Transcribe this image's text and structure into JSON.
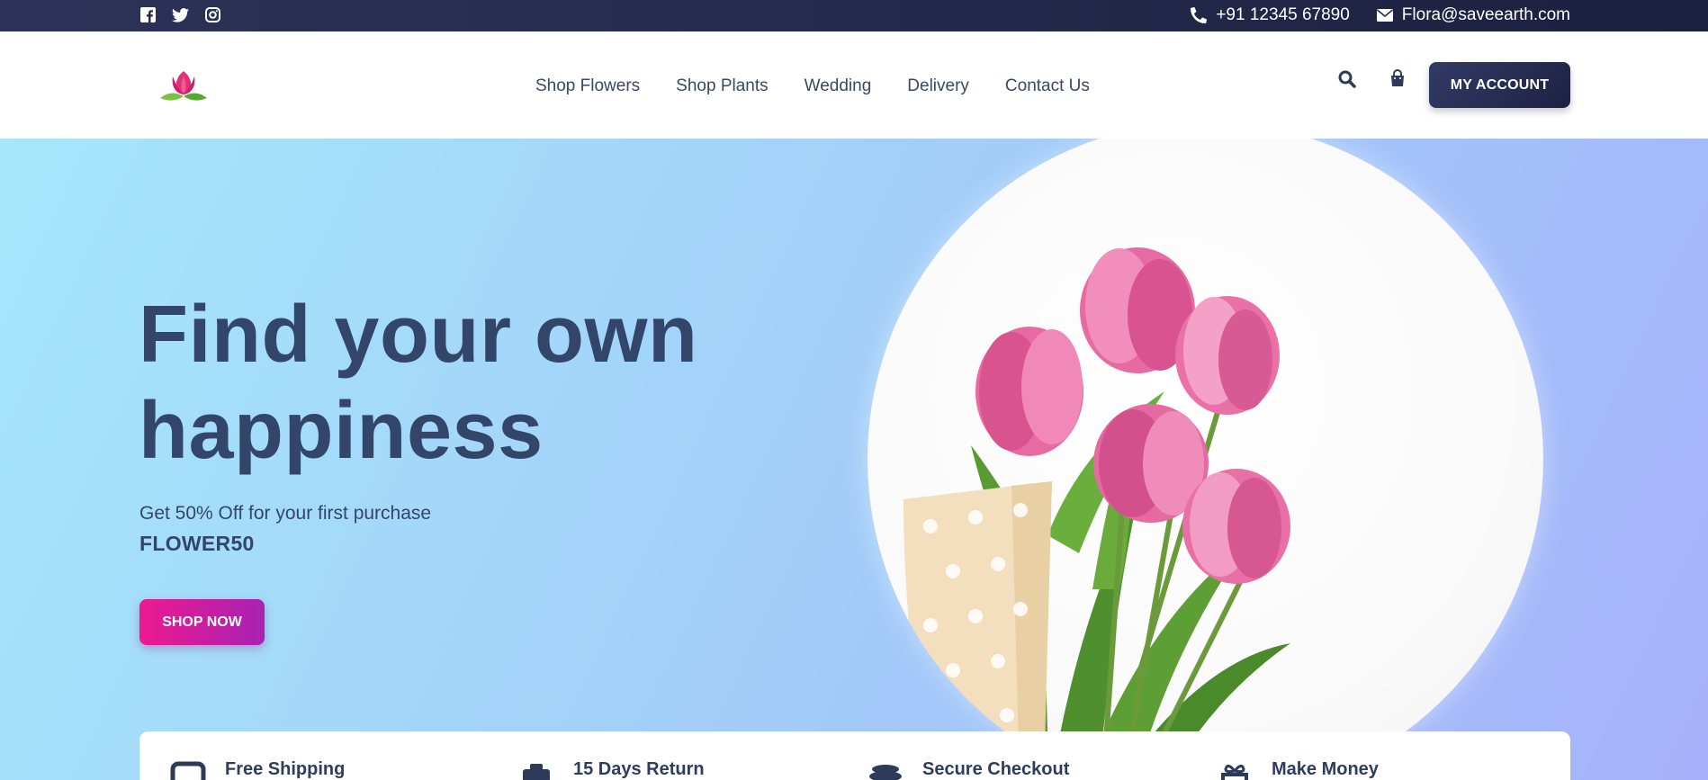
{
  "topbar": {
    "social": [
      "facebook-icon",
      "twitter-icon",
      "instagram-icon"
    ],
    "phone": "+91 12345 67890",
    "email": "Flora@saveearth.com"
  },
  "header": {
    "nav": [
      {
        "label": "Shop Flowers"
      },
      {
        "label": "Shop Plants"
      },
      {
        "label": "Wedding"
      },
      {
        "label": "Delivery"
      },
      {
        "label": "Contact Us"
      }
    ],
    "account_label": "MY ACCOUNT"
  },
  "hero": {
    "headline_line1": "Find your own",
    "headline_line2": "happiness",
    "offer_text": "Get 50% Off for your first purchase",
    "promo_code": "FLOWER50",
    "cta_label": "SHOP NOW"
  },
  "features": [
    {
      "title": "Free Shipping",
      "icon": "truck-icon"
    },
    {
      "title": "15 Days Return",
      "icon": "return-icon"
    },
    {
      "title": "Secure Checkout",
      "icon": "coins-icon"
    },
    {
      "title": "Make Money",
      "icon": "gift-icon"
    }
  ],
  "colors": {
    "topbar": "#2d3258",
    "text_dark": "#33466a",
    "cta_pink": "#ec1a8f",
    "cta_purple": "#a822b3",
    "hero_left": "#a6e7fb",
    "hero_right": "#a6b2fb"
  }
}
